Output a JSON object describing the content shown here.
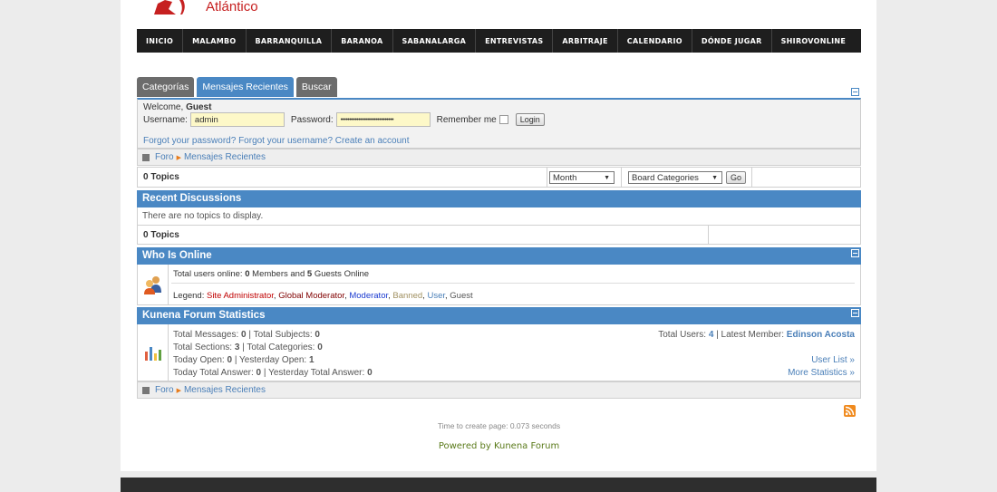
{
  "brand": {
    "logo_text": "Atlántico"
  },
  "nav": {
    "items": [
      "INICIO",
      "MALAMBO",
      "BARRANQUILLA",
      "BARANOA",
      "SABANALARGA",
      "ENTREVISTAS",
      "ARBITRAJE",
      "CALENDARIO",
      "DÓNDE JUGAR",
      "SHIROVONLINE"
    ]
  },
  "tabs": {
    "categorias": "Categorías",
    "recientes": "Mensajes Recientes",
    "buscar": "Buscar"
  },
  "login": {
    "welcome": "Welcome,",
    "user": "Guest",
    "username_label": "Username:",
    "username_value": "admin",
    "password_label": "Password:",
    "password_value": "••••••••••••••••••••••••••••••",
    "remember_label": "Remember me",
    "login_button": "Login",
    "forgot_password": "Forgot your password?",
    "forgot_username": "Forgot your username?",
    "create_account": "Create an account"
  },
  "breadcrumb": {
    "root": "Foro",
    "current": "Mensajes Recientes"
  },
  "topics": {
    "count_label": "0 Topics",
    "period": "Month",
    "category": "Board Categories",
    "go": "Go"
  },
  "recent": {
    "title": "Recent Discussions",
    "empty": "There are no topics to display.",
    "count_label": "0 Topics"
  },
  "online": {
    "title": "Who Is Online",
    "summary_prefix": "Total users online:",
    "members_count": "0",
    "members_label": "Members and",
    "guests_count": "5",
    "guests_label": "Guests Online",
    "legend_label": "Legend:",
    "legend": {
      "admin": "Site Administrator",
      "global": "Global Moderator",
      "moderator": "Moderator",
      "banned": "Banned",
      "user": "User",
      "guest": "Guest"
    }
  },
  "stats": {
    "title": "Kunena Forum Statistics",
    "total_messages_label": "Total Messages:",
    "total_messages": "0",
    "total_subjects_label": "Total Subjects:",
    "total_subjects": "0",
    "total_sections_label": "Total Sections:",
    "total_sections": "3",
    "total_categories_label": "Total Categories:",
    "total_categories": "0",
    "today_open_label": "Today Open:",
    "today_open": "0",
    "yesterday_open_label": "Yesterday Open:",
    "yesterday_open": "1",
    "today_answer_label": "Today Total Answer:",
    "today_answer": "0",
    "yesterday_answer_label": "Yesterday Total Answer:",
    "yesterday_answer": "0",
    "total_users_label": "Total Users:",
    "total_users": "4",
    "latest_member_label": "Latest Member:",
    "latest_member": "Edinson Acosta",
    "user_list": "User List »",
    "more_stats": "More Statistics »"
  },
  "footer": {
    "time": "Time to create page: 0.073 seconds",
    "powered": "Powered by Kunena Forum"
  },
  "colors": {
    "accent": "#4a88c4",
    "nav_bg": "#1e1e1e",
    "powered": "#5a7a1a",
    "admin": "#c00000",
    "moderator": "#1a3ad0"
  }
}
